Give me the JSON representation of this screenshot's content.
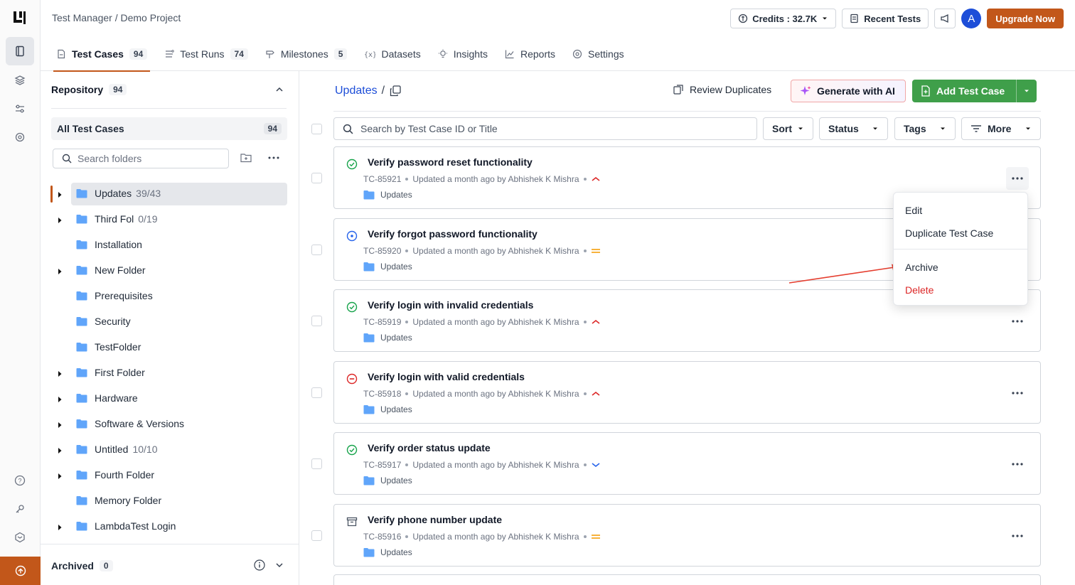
{
  "breadcrumb": {
    "app": "Test Manager",
    "separator": "/",
    "project": "Demo Project"
  },
  "topbar": {
    "credits_label": "Credits : 32.7K",
    "recent_tests_label": "Recent Tests",
    "avatar_initial": "A",
    "upgrade_label": "Upgrade Now",
    "accent_color": "#c2571a"
  },
  "tabs": [
    {
      "label": "Test Cases",
      "count": "94",
      "icon": "test-cases-icon",
      "active": true
    },
    {
      "label": "Test Runs",
      "count": "74",
      "icon": "test-runs-icon"
    },
    {
      "label": "Milestones",
      "count": "5",
      "icon": "milestone-icon"
    },
    {
      "label": "Datasets",
      "icon": "dataset-icon"
    },
    {
      "label": "Insights",
      "icon": "insights-icon"
    },
    {
      "label": "Reports",
      "icon": "reports-icon"
    },
    {
      "label": "Settings",
      "icon": "settings-icon"
    }
  ],
  "sidebar": {
    "repository_label": "Repository",
    "repository_count": "94",
    "all_test_cases_label": "All Test Cases",
    "all_test_cases_count": "94",
    "search_placeholder": "Search folders",
    "folders": [
      {
        "name": "Updates",
        "count": "39/43",
        "expandable": true,
        "selected": true
      },
      {
        "name": "Third Fol",
        "count": "0/19",
        "expandable": true
      },
      {
        "name": "Installation",
        "count": "",
        "expandable": false
      },
      {
        "name": "New Folder",
        "count": "",
        "expandable": true
      },
      {
        "name": "Prerequisites",
        "count": "",
        "expandable": false
      },
      {
        "name": "Security",
        "count": "",
        "expandable": false
      },
      {
        "name": "TestFolder",
        "count": "",
        "expandable": false
      },
      {
        "name": "First Folder",
        "count": "",
        "expandable": true
      },
      {
        "name": "Hardware",
        "count": "",
        "expandable": true
      },
      {
        "name": "Software & Versions",
        "count": "",
        "expandable": true
      },
      {
        "name": "Untitled",
        "count": "10/10",
        "expandable": true
      },
      {
        "name": "Fourth Folder",
        "count": "",
        "expandable": true
      },
      {
        "name": "Memory Folder",
        "count": "",
        "expandable": false
      },
      {
        "name": "LambdaTest Login",
        "count": "",
        "expandable": true
      }
    ],
    "archived_label": "Archived",
    "archived_count": "0"
  },
  "main": {
    "folder_title": "Updates",
    "title_separator": "/",
    "review_duplicates_label": "Review Duplicates",
    "generate_ai_label": "Generate with AI",
    "add_test_case_label": "Add Test Case",
    "search_placeholder": "Search by Test Case ID or Title",
    "filters": {
      "sort": "Sort",
      "status": "Status",
      "tags": "Tags",
      "more": "More"
    },
    "test_cases": [
      {
        "title": "Verify password reset functionality",
        "id": "TC-85921",
        "updated": "Updated a month ago by Abhishek K Mishra",
        "folder": "Updates",
        "status": "passed",
        "priority": "high"
      },
      {
        "title": "Verify forgot password functionality",
        "id": "TC-85920",
        "updated": "Updated a month ago by Abhishek K Mishra",
        "folder": "Updates",
        "status": "in-progress",
        "priority": "medium"
      },
      {
        "title": "Verify login with invalid credentials",
        "id": "TC-85919",
        "updated": "Updated a month ago by Abhishek K Mishra",
        "folder": "Updates",
        "status": "passed",
        "priority": "high"
      },
      {
        "title": "Verify login with valid credentials",
        "id": "TC-85918",
        "updated": "Updated a month ago by Abhishek K Mishra",
        "folder": "Updates",
        "status": "blocked",
        "priority": "high"
      },
      {
        "title": "Verify order status update",
        "id": "TC-85917",
        "updated": "Updated a month ago by Abhishek K Mishra",
        "folder": "Updates",
        "status": "passed",
        "priority": "low"
      },
      {
        "title": "Verify phone number update",
        "id": "TC-85916",
        "updated": "Updated a month ago by Abhishek K Mishra",
        "folder": "Updates",
        "status": "archived",
        "priority": "medium"
      }
    ]
  },
  "context_menu": {
    "edit": "Edit",
    "duplicate": "Duplicate Test Case",
    "archive": "Archive",
    "delete": "Delete"
  },
  "colors": {
    "passed": "#16a34a",
    "in_progress": "#2563eb",
    "blocked": "#dc2626",
    "high": "#dc2626",
    "medium": "#f59e0b",
    "low": "#2563eb",
    "folder": "#60a5fa",
    "primary_green": "#3f9f4a",
    "link_blue": "#1d4ed8"
  }
}
